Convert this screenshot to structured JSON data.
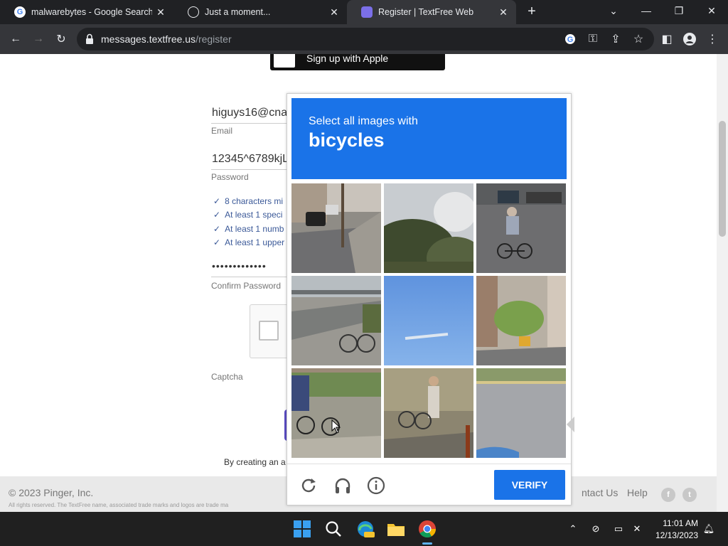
{
  "browser": {
    "tabs": [
      {
        "title": "malwarebytes - Google Search",
        "favicon": "google-icon",
        "active": false
      },
      {
        "title": "Just a moment...",
        "favicon": "globe-icon",
        "active": false
      },
      {
        "title": "Register | TextFree Web",
        "favicon": "textfree-icon",
        "active": true
      }
    ],
    "url_host": "messages.textfree.us",
    "url_path": "/register"
  },
  "form": {
    "apple_button": "Sign up with Apple",
    "email_value": "higuys16@cna",
    "email_label": "Email",
    "password_value": "12345^6789kjL",
    "password_label": "Password",
    "requirements": [
      "8 characters mi",
      "At least 1 speci",
      "At least 1 numb",
      "At least 1 upper"
    ],
    "confirm_value": "•••••••••••••",
    "confirm_label": "Confirm Password",
    "captcha_label": "Captcha",
    "terms_text": "By creating an a"
  },
  "footer": {
    "copyright": "© 2023 Pinger, Inc.",
    "legal": "All rights reserved. The TextFree name, associated trade marks and logos are trade ma",
    "contact": "ntact Us",
    "help": "Help"
  },
  "challenge": {
    "prompt": "Select all images with",
    "target": "bicycles",
    "verify_label": "VERIFY",
    "accent": "#1a73e8"
  },
  "taskbar": {
    "time": "11:01 AM",
    "date": "12/13/2023"
  }
}
